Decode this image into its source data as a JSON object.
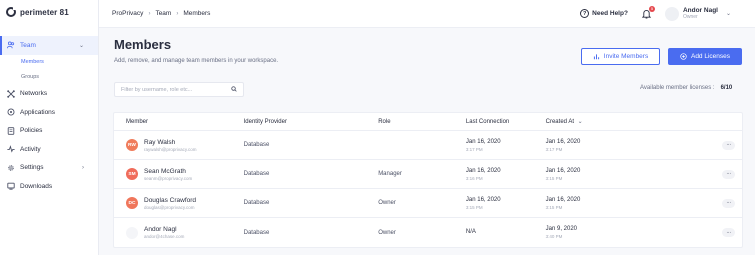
{
  "brand": {
    "name": "perimeter 81"
  },
  "sidebar": {
    "items": [
      {
        "label": "Team",
        "icon": "team-icon",
        "active": true,
        "expanded": true,
        "children": [
          {
            "label": "Members",
            "active": true
          },
          {
            "label": "Groups",
            "active": false
          }
        ]
      },
      {
        "label": "Networks",
        "icon": "networks-icon"
      },
      {
        "label": "Applications",
        "icon": "applications-icon"
      },
      {
        "label": "Policies",
        "icon": "policies-icon"
      },
      {
        "label": "Activity",
        "icon": "activity-icon"
      },
      {
        "label": "Settings",
        "icon": "settings-icon"
      },
      {
        "label": "Downloads",
        "icon": "downloads-icon"
      }
    ]
  },
  "breadcrumbs": [
    "ProPrivacy",
    "Team",
    "Members"
  ],
  "header": {
    "help_label": "Need Help?",
    "notification_count": "5",
    "user_name": "Andor Nagl",
    "user_role": "Owner"
  },
  "page": {
    "title": "Members",
    "subtitle": "Add, remove, and manage team members in your workspace.",
    "invite_label": "Invite Members",
    "add_licenses_label": "Add Licenses",
    "search_placeholder": "Filter by username, role etc...",
    "licenses_label": "Available member licenses :",
    "licenses_value": "6/10"
  },
  "table": {
    "columns": [
      "Member",
      "Identity Provider",
      "Role",
      "Last Connection",
      "Created At"
    ],
    "sort_indicator": "⌄",
    "rows": [
      {
        "initials": "RW",
        "avatar_color": "#f07c5b",
        "name": "Ray Walsh",
        "email": "raywalsh@proprivacy.com",
        "provider": "Database",
        "role": "",
        "last_date": "Jan 16, 2020",
        "last_time": "3:17 PM",
        "created_date": "Jan 16, 2020",
        "created_time": "3:17 PM"
      },
      {
        "initials": "SM",
        "avatar_color": "#f06c5b",
        "name": "Sean McGrath",
        "email": "seanm@proprivacy.com",
        "provider": "Database",
        "role": "Manager",
        "last_date": "Jan 16, 2020",
        "last_time": "3:16 PM",
        "created_date": "Jan 16, 2020",
        "created_time": "3:15 PM"
      },
      {
        "initials": "DC",
        "avatar_color": "#f0765b",
        "name": "Douglas Crawford",
        "email": "douglas@proprivacy.com",
        "provider": "Database",
        "role": "Owner",
        "last_date": "Jan 16, 2020",
        "last_time": "3:15 PM",
        "created_date": "Jan 16, 2020",
        "created_time": "3:15 PM"
      },
      {
        "initials": "",
        "avatar_color": "#f4f5f8",
        "name": "Andor Nagl",
        "email": "andor@4chase.com",
        "provider": "Database",
        "role": "Owner",
        "last_date": "N/A",
        "last_time": "",
        "created_date": "Jan 9, 2020",
        "created_time": "3:40 PM"
      }
    ],
    "more_label": "···"
  }
}
